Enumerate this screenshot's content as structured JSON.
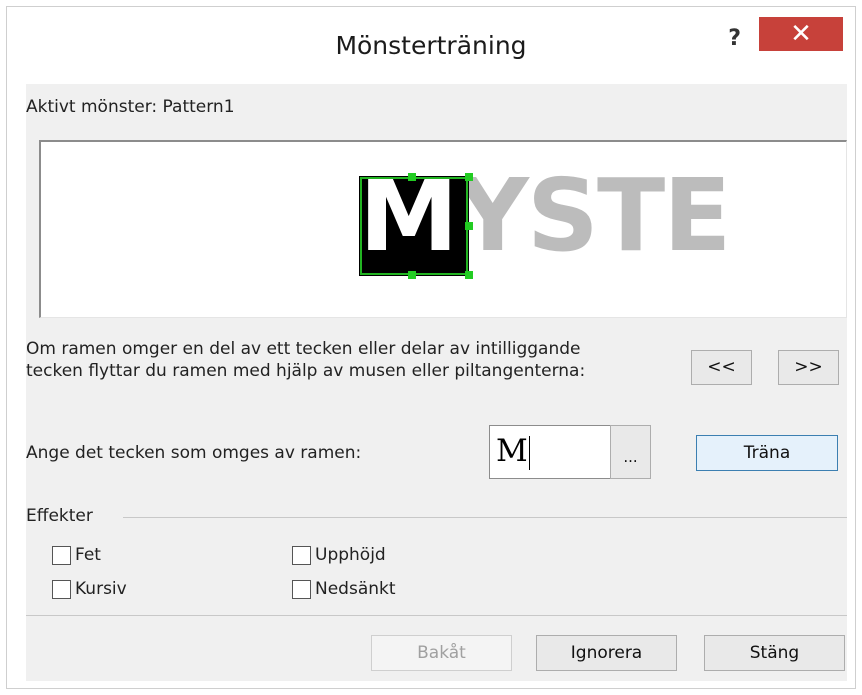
{
  "window": {
    "title": "Mönsterträning",
    "help_label": "?",
    "close_label": "✕"
  },
  "active_pattern": {
    "label": "Aktivt mönster:",
    "value": "Pattern1"
  },
  "preview": {
    "text": "MYSTE",
    "selected_char": "M"
  },
  "instructions": {
    "line1": "Om ramen omger en del av ett tecken eller delar av intilliggande",
    "line2": "tecken flyttar du ramen med hjälp av musen eller piltangenterna:",
    "prev_button": "<<",
    "next_button": ">>"
  },
  "char_entry": {
    "label": "Ange det tecken som omges av ramen:",
    "value": "M",
    "browse_button": "...",
    "train_button": "Träna"
  },
  "effects": {
    "heading": "Effekter",
    "items": [
      {
        "label": "Fet",
        "checked": false
      },
      {
        "label": "Kursiv",
        "checked": false
      },
      {
        "label": "Upphöjd",
        "checked": false
      },
      {
        "label": "Nedsänkt",
        "checked": false
      }
    ]
  },
  "footer": {
    "back_button": "Bakåt",
    "ignore_button": "Ignorera",
    "close_button": "Stäng"
  }
}
